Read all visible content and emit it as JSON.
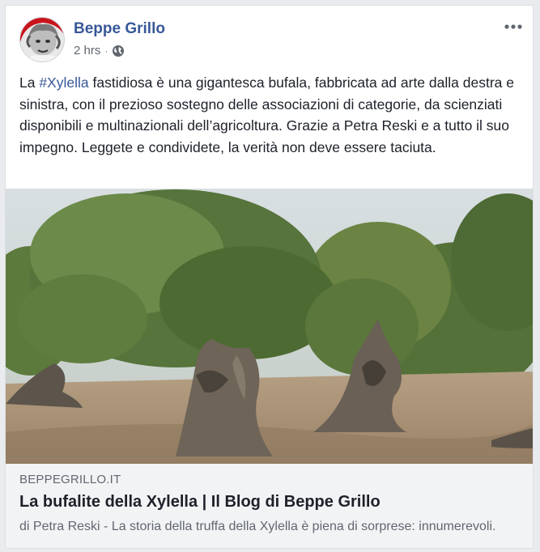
{
  "post": {
    "author": "Beppe Grillo",
    "timestamp": "2 hrs",
    "separator": "·",
    "privacy_icon": "globe-icon",
    "text_before": "La ",
    "hashtag": "#Xylella",
    "text_after": " fastidiosa è una gigantesca bufala, fabbricata ad arte dalla destra e sinistra, con il prezioso sostegno delle associazioni di categorie, da scienziati disponibili e multinazionali dell’agricoltura. Grazie a Petra Reski e a tutto il suo impegno. Leggete e condividete, la verità non deve essere taciuta.",
    "more_icon": "more-options-icon"
  },
  "link": {
    "domain": "BEPPEGRILLO.IT",
    "title": "La bufalite della Xylella | Il Blog di Beppe Grillo",
    "description": "di Petra Reski - La storia della truffa della Xylella è piena di sorprese: innumerevoli."
  },
  "colors": {
    "author_blue": "#385898",
    "text": "#1d2129",
    "muted": "#606770",
    "link_bg": "#f2f3f5"
  }
}
